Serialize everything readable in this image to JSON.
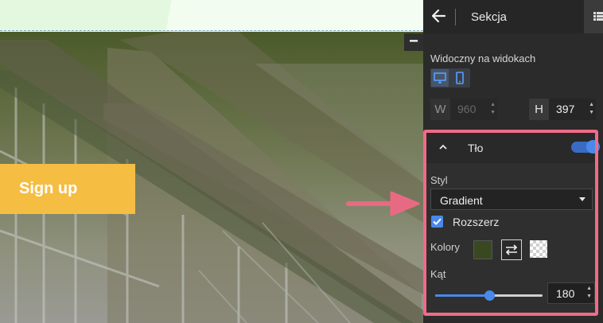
{
  "canvas": {
    "signup_label": "Sign up",
    "collapse_symbol": "−"
  },
  "panel": {
    "title": "Sekcja",
    "back_icon": "arrow-left-icon",
    "layout_icon": "grid-icon",
    "visibility": {
      "label": "Widoczny na widokach",
      "desktop_icon": "desktop-icon",
      "mobile_icon": "mobile-icon",
      "desktop_active": true,
      "mobile_active": true
    },
    "width": {
      "letter": "W",
      "value": "960",
      "disabled": true
    },
    "height": {
      "letter": "H",
      "value": "397"
    },
    "background": {
      "title": "Tło",
      "enabled": true,
      "style_label": "Styl",
      "style_value": "Gradient",
      "extend_label": "Rozszerz",
      "extend_checked": true,
      "colors_label": "Kolory",
      "color_1": "#3a4822",
      "color_2": "transparent",
      "swap_icon": "swap-arrows-icon",
      "angle_label": "Kąt",
      "angle_value": "180",
      "angle_max": 360
    }
  },
  "colors": {
    "highlight": "#f06b87",
    "accent": "#4a88ea",
    "signup_button": "#f6bd43",
    "panel_bg": "#2b2b2b"
  }
}
